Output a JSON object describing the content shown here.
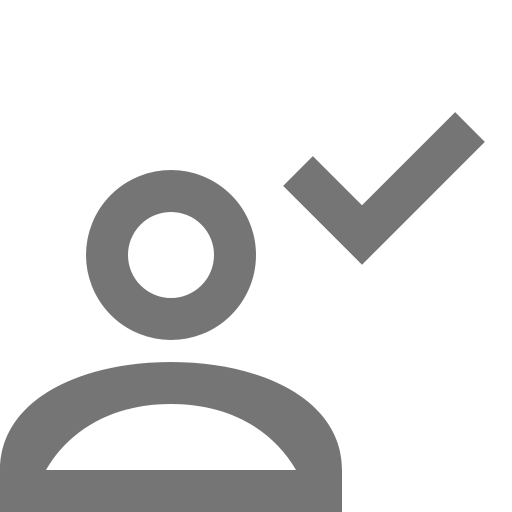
{
  "icon": {
    "name": "user-check-icon",
    "color": "#757575",
    "background": "#ffffff",
    "parts": [
      "user-head-icon",
      "user-body-icon",
      "checkmark-icon"
    ]
  }
}
